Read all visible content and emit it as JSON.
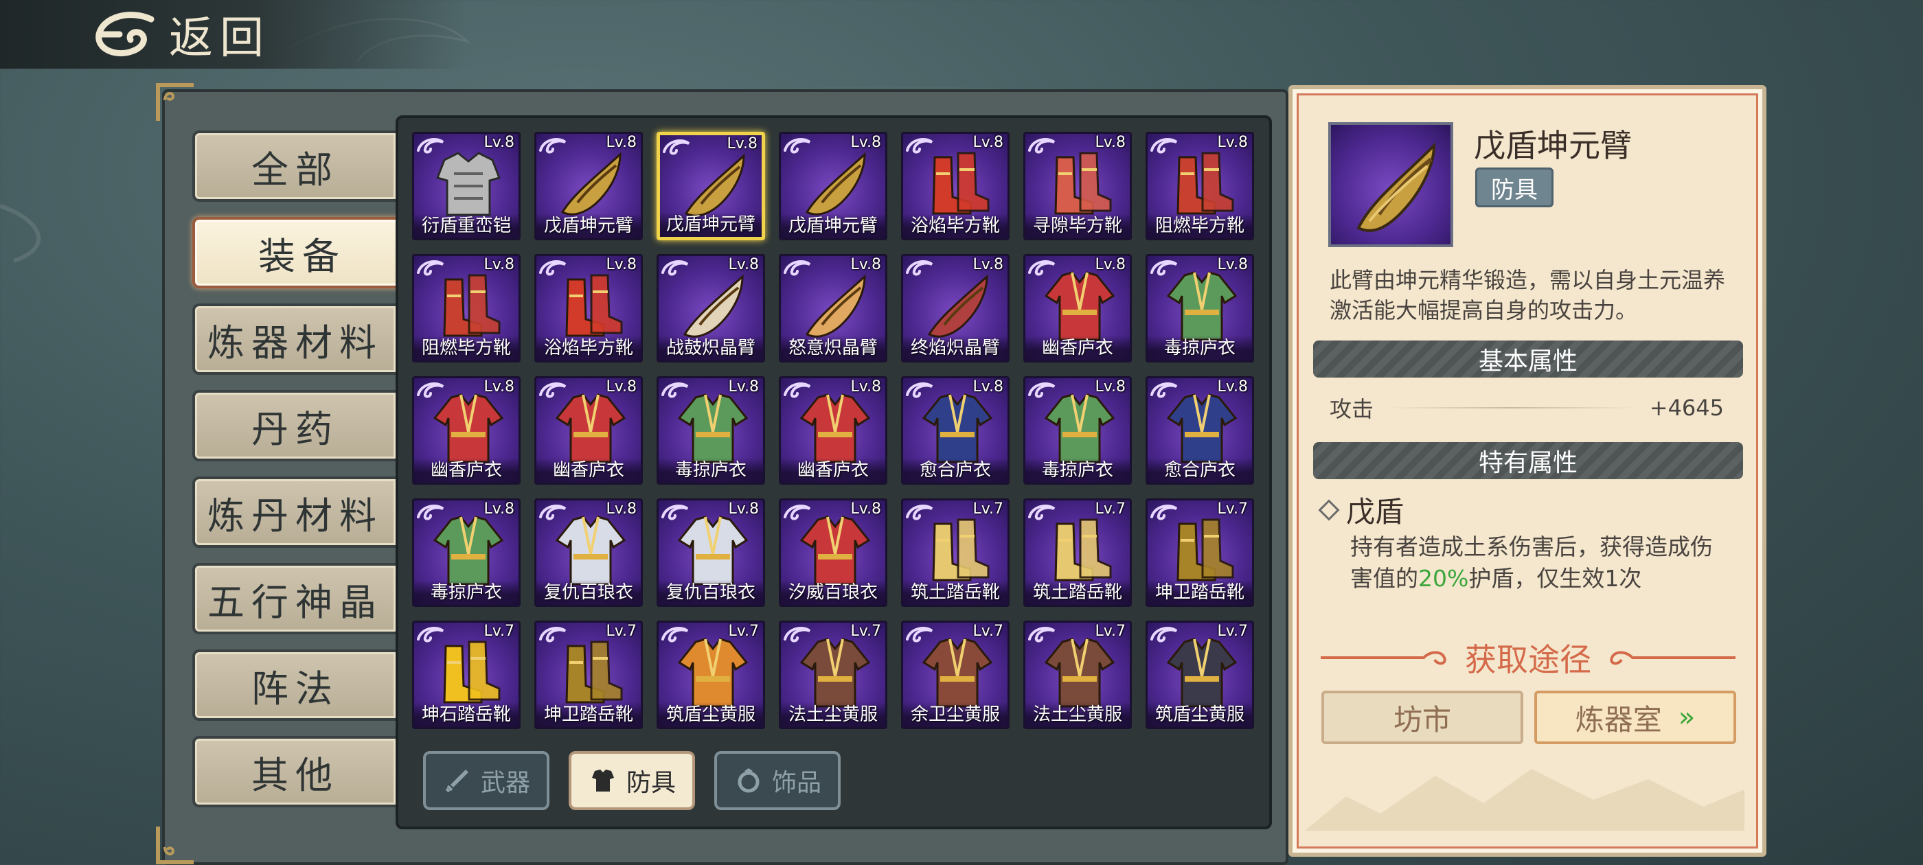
{
  "header": {
    "back_label": "返回"
  },
  "categories": [
    {
      "label": "全部",
      "active": false
    },
    {
      "label": "装备",
      "active": true
    },
    {
      "label": "炼器材料",
      "active": false
    },
    {
      "label": "丹药",
      "active": false
    },
    {
      "label": "炼丹材料",
      "active": false
    },
    {
      "label": "五行神晶",
      "active": false
    },
    {
      "label": "阵法",
      "active": false
    },
    {
      "label": "其他",
      "active": false
    }
  ],
  "items": [
    {
      "level": "Lv.8",
      "name": "衍盾重峦铠",
      "icon": "armor-icon",
      "color": "#b8b8b8"
    },
    {
      "level": "Lv.8",
      "name": "戊盾坤元臂",
      "icon": "bracer-icon",
      "color": "#c8a040"
    },
    {
      "level": "Lv.8",
      "name": "戊盾坤元臂",
      "icon": "bracer-icon",
      "color": "#c8a040",
      "selected": true
    },
    {
      "level": "Lv.8",
      "name": "戊盾坤元臂",
      "icon": "bracer-icon",
      "color": "#c8a040"
    },
    {
      "level": "Lv.8",
      "name": "浴焰毕方靴",
      "icon": "boots-icon",
      "color": "#d23a2a"
    },
    {
      "level": "Lv.8",
      "name": "寻隙毕方靴",
      "icon": "boots-icon",
      "color": "#d65c4c"
    },
    {
      "level": "Lv.8",
      "name": "阻燃毕方靴",
      "icon": "boots-icon",
      "color": "#c84030"
    },
    {
      "level": "Lv.8",
      "name": "阻燃毕方靴",
      "icon": "boots-icon",
      "color": "#c84030"
    },
    {
      "level": "Lv.8",
      "name": "浴焰毕方靴",
      "icon": "boots-icon",
      "color": "#d23a2a"
    },
    {
      "level": "Lv.8",
      "name": "战鼓炽晶臂",
      "icon": "bracer-icon",
      "color": "#e2d4b8"
    },
    {
      "level": "Lv.8",
      "name": "怒意炽晶臂",
      "icon": "bracer-icon",
      "color": "#e0a860"
    },
    {
      "level": "Lv.8",
      "name": "终焰炽晶臂",
      "icon": "bracer-icon",
      "color": "#b04040"
    },
    {
      "level": "Lv.8",
      "name": "幽香庐衣",
      "icon": "robe-icon",
      "color": "#c8383a"
    },
    {
      "level": "Lv.8",
      "name": "毒掠庐衣",
      "icon": "robe-icon",
      "color": "#5c9a5c"
    },
    {
      "level": "Lv.8",
      "name": "幽香庐衣",
      "icon": "robe-icon",
      "color": "#c8383a"
    },
    {
      "level": "Lv.8",
      "name": "幽香庐衣",
      "icon": "robe-icon",
      "color": "#c8383a"
    },
    {
      "level": "Lv.8",
      "name": "毒掠庐衣",
      "icon": "robe-icon",
      "color": "#5c9a5c"
    },
    {
      "level": "Lv.8",
      "name": "幽香庐衣",
      "icon": "robe-icon",
      "color": "#c8383a"
    },
    {
      "level": "Lv.8",
      "name": "愈合庐衣",
      "icon": "robe-icon",
      "color": "#2f3f8a"
    },
    {
      "level": "Lv.8",
      "name": "毒掠庐衣",
      "icon": "robe-icon",
      "color": "#5c9a5c"
    },
    {
      "level": "Lv.8",
      "name": "愈合庐衣",
      "icon": "robe-icon",
      "color": "#2f3f8a"
    },
    {
      "level": "Lv.8",
      "name": "毒掠庐衣",
      "icon": "robe-icon",
      "color": "#5c9a5c"
    },
    {
      "level": "Lv.8",
      "name": "复仇百琅衣",
      "icon": "robe-icon",
      "color": "#d8dce6"
    },
    {
      "level": "Lv.8",
      "name": "复仇百琅衣",
      "icon": "robe-icon",
      "color": "#d8dce6"
    },
    {
      "level": "Lv.8",
      "name": "汐威百琅衣",
      "icon": "robe-icon",
      "color": "#c8383a"
    },
    {
      "level": "Lv.7",
      "name": "筑土踏岳靴",
      "icon": "boots-icon",
      "color": "#e6c870"
    },
    {
      "level": "Lv.7",
      "name": "筑土踏岳靴",
      "icon": "boots-icon",
      "color": "#e6c870"
    },
    {
      "level": "Lv.7",
      "name": "坤卫踏岳靴",
      "icon": "boots-icon",
      "color": "#a88428"
    },
    {
      "level": "Lv.7",
      "name": "坤石踏岳靴",
      "icon": "boots-icon",
      "color": "#f0c020"
    },
    {
      "level": "Lv.7",
      "name": "坤卫踏岳靴",
      "icon": "boots-icon",
      "color": "#a88428"
    },
    {
      "level": "Lv.7",
      "name": "筑盾尘黄服",
      "icon": "robe-icon",
      "color": "#e08a30"
    },
    {
      "level": "Lv.7",
      "name": "法土尘黄服",
      "icon": "robe-icon",
      "color": "#7a4a3a"
    },
    {
      "level": "Lv.7",
      "name": "余卫尘黄服",
      "icon": "robe-icon",
      "color": "#8a4a3a"
    },
    {
      "level": "Lv.7",
      "name": "法土尘黄服",
      "icon": "robe-icon",
      "color": "#7a4a3a"
    },
    {
      "level": "Lv.7",
      "name": "筑盾尘黄服",
      "icon": "robe-icon",
      "color": "#3a3a4a"
    }
  ],
  "sub_tabs": [
    {
      "label": "武器",
      "icon": "sword-icon",
      "active": false
    },
    {
      "label": "防具",
      "icon": "armor-icon",
      "active": true
    },
    {
      "label": "饰品",
      "icon": "ring-icon",
      "active": false
    }
  ],
  "detail": {
    "name": "戊盾坤元臂",
    "type": "防具",
    "description": "此臂由坤元精华锻造，需以自身土元温养激活能大幅提高自身的攻击力。",
    "basic_title": "基本属性",
    "attr_label": "攻击",
    "attr_value": "+4645",
    "special_title": "特有属性",
    "special_name": "戊盾",
    "special_desc_before": "持有者造成土系伤害后，获得造成伤害值的",
    "special_desc_pct": "20%",
    "special_desc_after": "护盾，仅生效1次",
    "obtain_title": "获取途径",
    "obtain_buttons": [
      "坊市",
      "炼器室"
    ]
  }
}
